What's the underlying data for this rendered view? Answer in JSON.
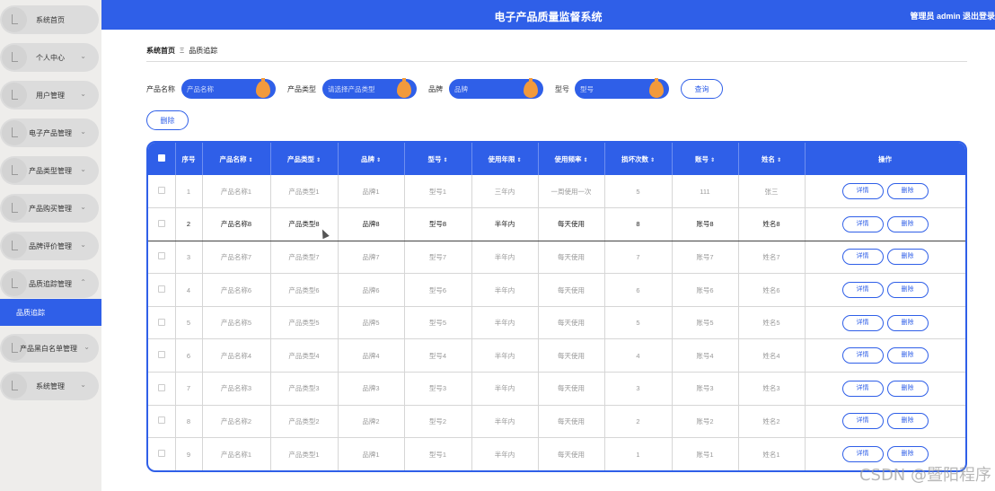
{
  "header": {
    "title": "电子产品质量监督系统",
    "user": "管理员 admin  退出登录"
  },
  "sidebar": {
    "items": [
      {
        "label": "系统首页",
        "chevron": ""
      },
      {
        "label": "个人中心",
        "chevron": "⌄"
      },
      {
        "label": "用户管理",
        "chevron": "⌄"
      },
      {
        "label": "电子产品管理",
        "chevron": "⌄"
      },
      {
        "label": "产品类型管理",
        "chevron": "⌄"
      },
      {
        "label": "产品购买管理",
        "chevron": "⌄"
      },
      {
        "label": "品牌评价管理",
        "chevron": "⌄"
      },
      {
        "label": "品质追踪管理",
        "chevron": "⌃"
      },
      {
        "label": "产品黑白名单管理",
        "chevron": "⌄"
      },
      {
        "label": "系统管理",
        "chevron": "⌄"
      }
    ],
    "active_sub": "品质追踪"
  },
  "breadcrumb": {
    "home": "系统首页",
    "sep": "Ξ",
    "current": "品质追踪"
  },
  "search": {
    "name_label": "产品名称",
    "name_placeholder": "产品名称",
    "type_label": "产品类型",
    "type_placeholder": "请选择产品类型",
    "brand_label": "品牌",
    "brand_placeholder": "品牌",
    "model_label": "型号",
    "model_placeholder": "型号",
    "query_button": "查询"
  },
  "toolbar": {
    "delete_button": "删除"
  },
  "table": {
    "headers": [
      "序号",
      "产品名称",
      "产品类型",
      "品牌",
      "型号",
      "使用年限",
      "使用频率",
      "损坏次数",
      "账号",
      "姓名",
      "操作"
    ],
    "sortable": [
      false,
      true,
      true,
      true,
      true,
      true,
      true,
      true,
      true,
      true,
      false
    ],
    "sort_glyph": "⇕",
    "detail_label": "详情",
    "delete_label": "删除",
    "rows": [
      {
        "no": "1",
        "name": "产品名称1",
        "type": "产品类型1",
        "brand": "品牌1",
        "model": "型号1",
        "years": "三年内",
        "freq": "一周使用一次",
        "damage": "5",
        "account": "111",
        "person": "张三"
      },
      {
        "no": "2",
        "name": "产品名称8",
        "type": "产品类型8",
        "brand": "品牌8",
        "model": "型号8",
        "years": "半年内",
        "freq": "每天使用",
        "damage": "8",
        "account": "账号8",
        "person": "姓名8"
      },
      {
        "no": "3",
        "name": "产品名称7",
        "type": "产品类型7",
        "brand": "品牌7",
        "model": "型号7",
        "years": "半年内",
        "freq": "每天使用",
        "damage": "7",
        "account": "账号7",
        "person": "姓名7"
      },
      {
        "no": "4",
        "name": "产品名称6",
        "type": "产品类型6",
        "brand": "品牌6",
        "model": "型号6",
        "years": "半年内",
        "freq": "每天使用",
        "damage": "6",
        "account": "账号6",
        "person": "姓名6"
      },
      {
        "no": "5",
        "name": "产品名称5",
        "type": "产品类型5",
        "brand": "品牌5",
        "model": "型号5",
        "years": "半年内",
        "freq": "每天使用",
        "damage": "5",
        "account": "账号5",
        "person": "姓名5"
      },
      {
        "no": "6",
        "name": "产品名称4",
        "type": "产品类型4",
        "brand": "品牌4",
        "model": "型号4",
        "years": "半年内",
        "freq": "每天使用",
        "damage": "4",
        "account": "账号4",
        "person": "姓名4"
      },
      {
        "no": "7",
        "name": "产品名称3",
        "type": "产品类型3",
        "brand": "品牌3",
        "model": "型号3",
        "years": "半年内",
        "freq": "每天使用",
        "damage": "3",
        "account": "账号3",
        "person": "姓名3"
      },
      {
        "no": "8",
        "name": "产品名称2",
        "type": "产品类型2",
        "brand": "品牌2",
        "model": "型号2",
        "years": "半年内",
        "freq": "每天使用",
        "damage": "2",
        "account": "账号2",
        "person": "姓名2"
      },
      {
        "no": "9",
        "name": "产品名称1",
        "type": "产品类型1",
        "brand": "品牌1",
        "model": "型号1",
        "years": "半年内",
        "freq": "每天使用",
        "damage": "1",
        "account": "账号1",
        "person": "姓名1"
      }
    ]
  },
  "watermark": "CSDN @暨阳程序"
}
